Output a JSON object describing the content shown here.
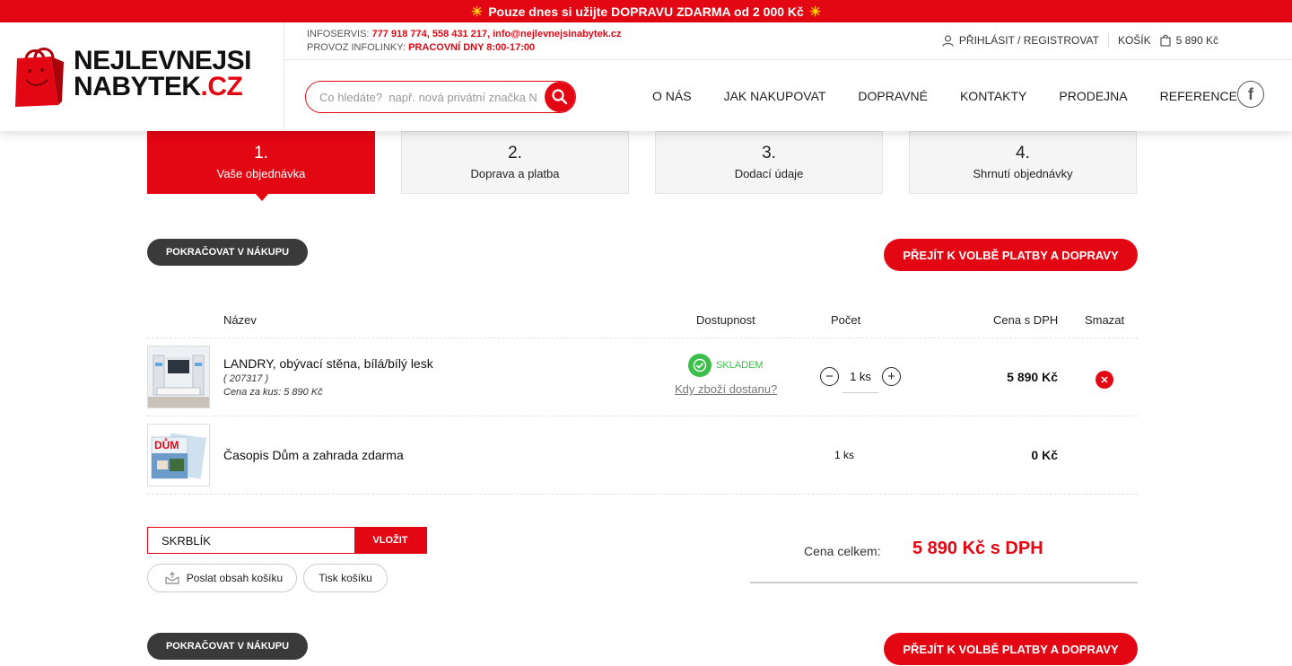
{
  "promo": {
    "text": "Pouze dnes si užijte DOPRAVU ZDARMA od 2 000 Kč"
  },
  "logo": {
    "line1": "NEJLEVNEJSI",
    "line2_main": "NABYTEK",
    "line2_tld": ".CZ"
  },
  "info": {
    "infoservis_label": "INFOSERVIS:",
    "infoservis_value": "777 918 774, 558 431 217, info@nejlevnejsinabytek.cz",
    "provoz_label": "PROVOZ INFOLINKY:",
    "provoz_value": "PRACOVNÍ DNY 8:00-17:00"
  },
  "user_bar": {
    "login": "PŘIHLÁSIT / REGISTROVAT",
    "cart_label": "KOŠÍK",
    "cart_total": "5 890 Kč"
  },
  "search": {
    "placeholder": "Co hledáte?  např. nová privátní značka N"
  },
  "nav": [
    "O NÁS",
    "JAK NAKUPOVAT",
    "DOPRAVNÉ",
    "KONTAKTY",
    "PRODEJNA",
    "REFERENCE"
  ],
  "steps": [
    {
      "num": "1.",
      "label": "Vaše objednávka"
    },
    {
      "num": "2.",
      "label": "Doprava a platba"
    },
    {
      "num": "3.",
      "label": "Dodací údaje"
    },
    {
      "num": "4.",
      "label": "Shrnutí objednávky"
    }
  ],
  "buttons": {
    "continue": "POKRAČOVAT V NÁKUPU",
    "proceed": "PŘEJÍT K VOLBĚ PLATBY A DOPRAVY"
  },
  "table": {
    "headers": {
      "name": "Název",
      "availability": "Dostupnost",
      "count": "Počet",
      "price": "Cena s DPH",
      "delete": "Smazat"
    }
  },
  "items": [
    {
      "name": "LANDRY, obývací stěna, bílá/bílý lesk",
      "code": "( 207317 )",
      "unit_price": "Cena za kus: 5 890 Kč",
      "stock": "SKLADEM",
      "stock_link": "Kdy zboží dostanu?",
      "qty": "1 ks",
      "price": "5 890 Kč"
    },
    {
      "name": "Časopis Dům a zahrada zdarma",
      "qty": "1 ks",
      "price": "0 Kč",
      "thumb_text": "DŮM"
    }
  ],
  "coupon": {
    "value": "SKRBLÍK",
    "button": "VLOŽIT"
  },
  "actions": {
    "send": "Poslat obsah košíku",
    "print": "Tisk košíku"
  },
  "total": {
    "label": "Cena celkem:",
    "value": "5 890 Kč s DPH"
  },
  "colors": {
    "brand_red": "#e30613",
    "dark": "#3a3a3a",
    "stock_green": "#3cbe4a"
  }
}
